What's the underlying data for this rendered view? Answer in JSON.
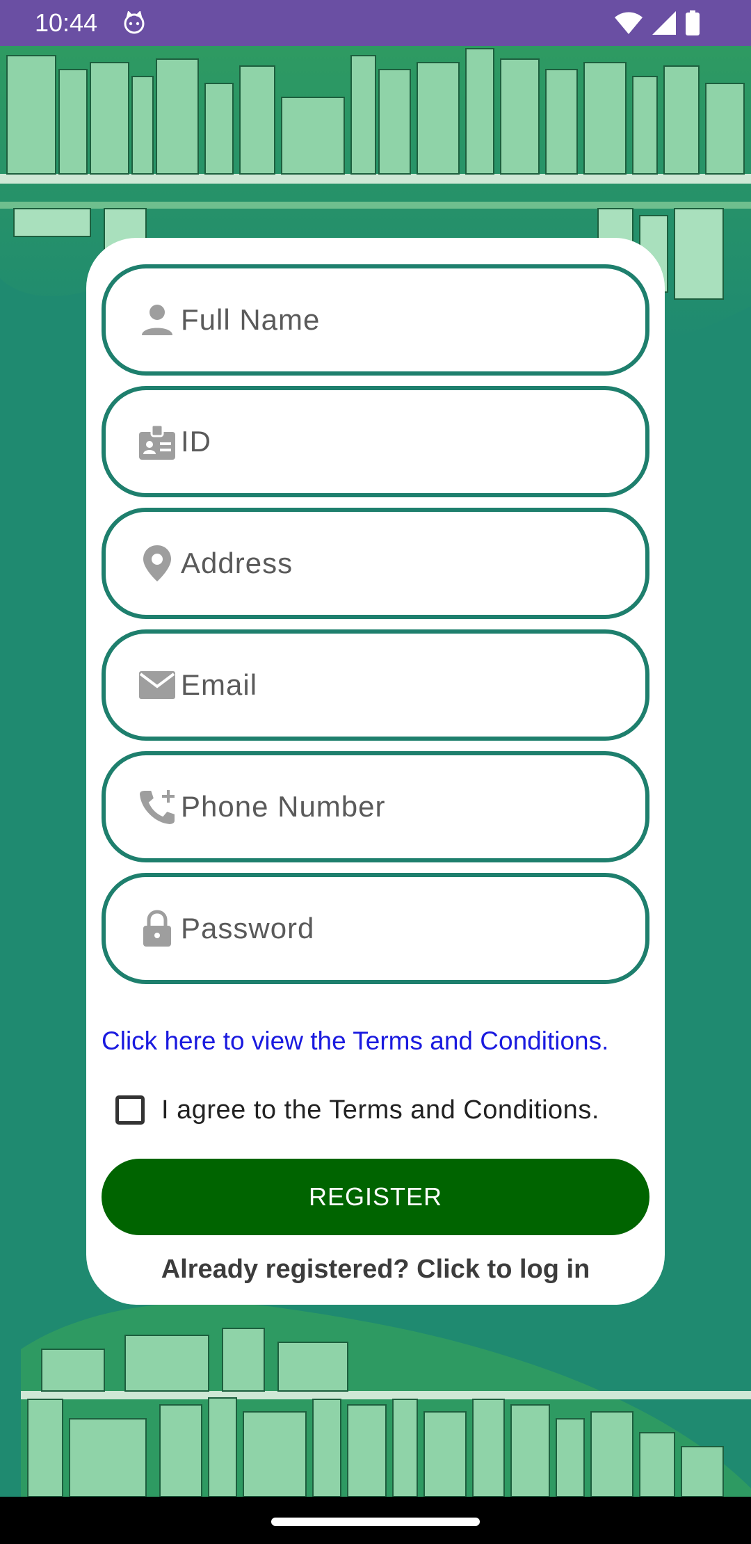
{
  "status_bar": {
    "time": "10:44",
    "icons": [
      "cat-icon",
      "wifi-icon",
      "signal-icon",
      "battery-icon"
    ]
  },
  "form": {
    "fields": [
      {
        "name": "full-name-field",
        "icon": "person-icon",
        "placeholder": "Full Name",
        "value": ""
      },
      {
        "name": "id-field",
        "icon": "id-badge-icon",
        "placeholder": "ID",
        "value": ""
      },
      {
        "name": "address-field",
        "icon": "location-pin-icon",
        "placeholder": "Address",
        "value": ""
      },
      {
        "name": "email-field",
        "icon": "mail-icon",
        "placeholder": "Email",
        "value": ""
      },
      {
        "name": "phone-field",
        "icon": "add-call-icon",
        "placeholder": "Phone Number",
        "value": ""
      },
      {
        "name": "password-field",
        "icon": "lock-icon",
        "placeholder": "Password",
        "value": ""
      }
    ],
    "terms_link": "Click here to view the Terms and Conditions.",
    "agree_label": "I agree to the Terms and Conditions.",
    "agree_checked": false,
    "register_label": "REGISTER",
    "login_link": "Already registered? Click to log in"
  },
  "colors": {
    "status_bar": "#6a4fa3",
    "background": "#1f8a70",
    "field_border": "#1e7f6d",
    "register_button": "#006400",
    "terms_link": "#1a1adf"
  }
}
